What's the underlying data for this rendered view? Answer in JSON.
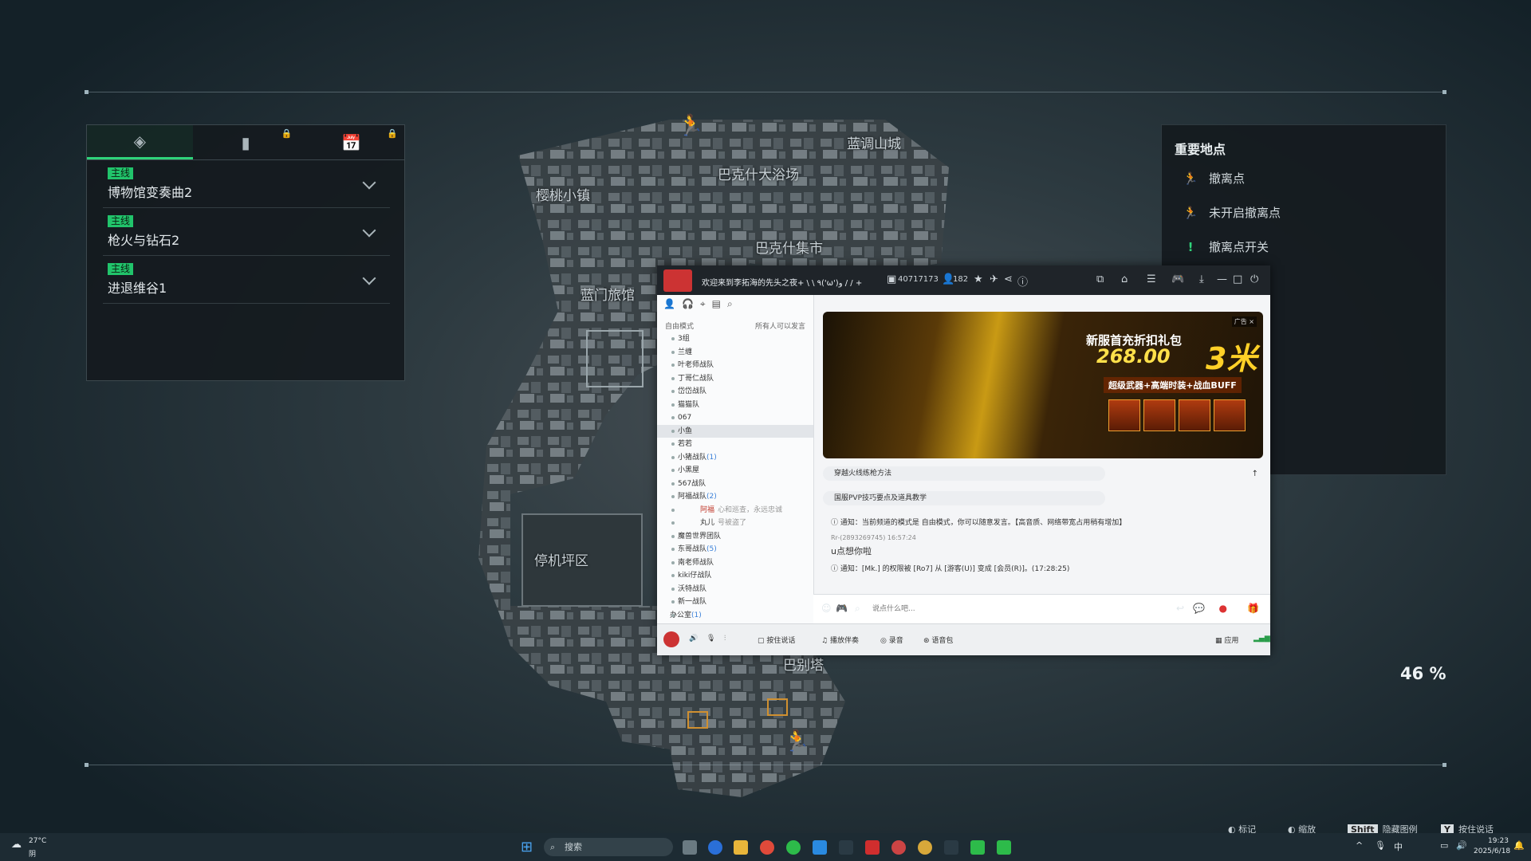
{
  "map": {
    "labels": [
      "樱桃小镇",
      "巴克什大浴场",
      "蓝调山城",
      "巴克什集市",
      "蓝门旅馆",
      "停机坪区",
      "巴别塔"
    ],
    "zoom_percent": "46 %"
  },
  "quest_panel": {
    "tabs": [
      {
        "icon": "diamond-alert-icon",
        "active": true
      },
      {
        "icon": "exclamation-card-icon",
        "locked": true
      },
      {
        "icon": "calendar-icon",
        "locked": true
      }
    ],
    "quests": [
      {
        "badge": "主线",
        "title": "博物馆变奏曲2"
      },
      {
        "badge": "主线",
        "title": "枪火与钻石2"
      },
      {
        "badge": "主线",
        "title": "进退维谷1"
      }
    ]
  },
  "legend": {
    "header": "重要地点",
    "items": [
      {
        "label": "撤离点",
        "icon": "running-man-icon",
        "color": "#2fd37a"
      },
      {
        "label": "未开启撤离点",
        "icon": "running-man-gray-icon",
        "color": "#8a9499"
      },
      {
        "label": "撤离点开关",
        "icon": "exclamation-icon",
        "color": "#2fd37a"
      }
    ]
  },
  "chat": {
    "title": "欢迎来到李拓海的先头之夜+ \\ \\ ٩('ω')و / / +",
    "room_id": "40717173",
    "online": "182",
    "sidebar": {
      "mode": "自由模式",
      "mode_hint": "所有人可以发言",
      "channels": [
        {
          "name": "3组"
        },
        {
          "name": "兰缠"
        },
        {
          "name": "叶老师战队"
        },
        {
          "name": "丁哥仁战队"
        },
        {
          "name": "岱岱战队"
        },
        {
          "name": "猫猫队"
        },
        {
          "name": "067"
        },
        {
          "name": "小鱼",
          "selected": true
        },
        {
          "name": "若若"
        },
        {
          "name": "小猪战队",
          "count": "(1)"
        },
        {
          "name": "小黑屋"
        },
        {
          "name": "567战队"
        },
        {
          "name": "阿福战队",
          "count": "(2)"
        },
        {
          "name": "阿福",
          "sub": "心和巡查，永远忠诚",
          "user": true
        },
        {
          "name": "丸儿",
          "sub": "号被盗了",
          "user": true
        },
        {
          "name": "魔兽世界团队"
        },
        {
          "name": "东哥战队",
          "count": "(5)"
        },
        {
          "name": "南老师战队"
        },
        {
          "name": "kiki仔战队"
        },
        {
          "name": "沃特战队"
        },
        {
          "name": "新一战队"
        },
        {
          "name": "办公室",
          "count": "(1)"
        }
      ]
    },
    "banner": {
      "ad": "广告 ×",
      "title": "新服首充折扣礼包",
      "price": "268.00",
      "big": "3米",
      "sub": "超级武器+高端时装+战血BUFF"
    },
    "messages": {
      "tip1": "穿越火线练枪方法",
      "tip2": "国服PVP技巧要点及道具教学",
      "notice1": "通知：当前频道的模式是 自由模式，你可以随意发言。【高音质、网络带宽占用稍有增加】",
      "user_line": "Rr-(2893269745)  16:57:24",
      "user_msg": "u点想你啦",
      "notice2": "通知：[Mk.] 的权限被 [Ro7] 从 [游客(U)] 变成 [会员(R)]。(17:28:25)"
    },
    "input_placeholder": "说点什么吧...",
    "bottom_bar": {
      "share": "按住说话",
      "music": "播放伴奏",
      "record": "录音",
      "voice_pack": "语音包",
      "apps": "应用"
    }
  },
  "hints": {
    "mark": "标记",
    "zoom": "缩放",
    "shift_key": "Shift",
    "hide_legend": "隐藏图例",
    "y_key": "Y",
    "talk": "按住说话"
  },
  "taskbar": {
    "weather_temp": "27°C",
    "weather_desc": "阴",
    "search_placeholder": "搜索",
    "time": "19:23",
    "date": "2025/6/18",
    "ime": "中"
  },
  "colors": {
    "accent_green": "#2fd37a",
    "panel_bg": "#14191e"
  }
}
